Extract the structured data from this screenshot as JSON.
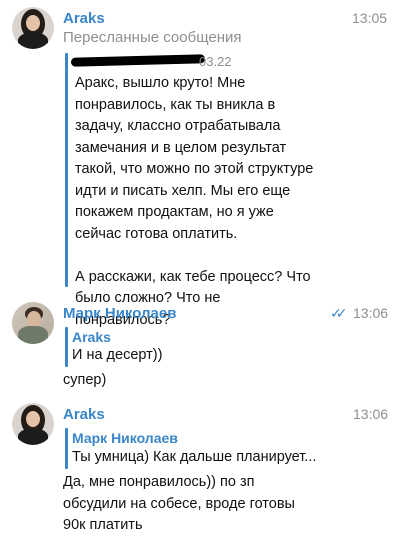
{
  "messages": [
    {
      "sender": "Araks",
      "time": "13:05",
      "subtitle": "Пересланные сообщения",
      "quote_time": "03.22",
      "text": "Аракс, вышло круто! Мне понравилось, как ты вникла в задачу, классно отрабатывала замечания и в целом результат такой, что можно по этой структуре идти и писать хелп. Мы его еще покажем продактам, но я уже сейчас готова оплатить.\n\nА расскажи, как тебе процесс? Что было сложно? Что не понравилось?"
    },
    {
      "sender": "Марк Николаев",
      "time": "13:06",
      "read_icon": "double-check-icon",
      "quote_title": "Araks",
      "quote_text": "И на десерт))",
      "text": "супер)"
    },
    {
      "sender": "Araks",
      "time": "13:06",
      "quote_title": "Марк Николаев",
      "quote_text": "Ты умница) Как дальше планирует...",
      "text": "Да, мне понравилось)) по зп обсудили на собесе, вроде готовы 90к платить"
    }
  ],
  "colors": {
    "accent": "#3a86c8",
    "muted": "#8e8e93"
  }
}
